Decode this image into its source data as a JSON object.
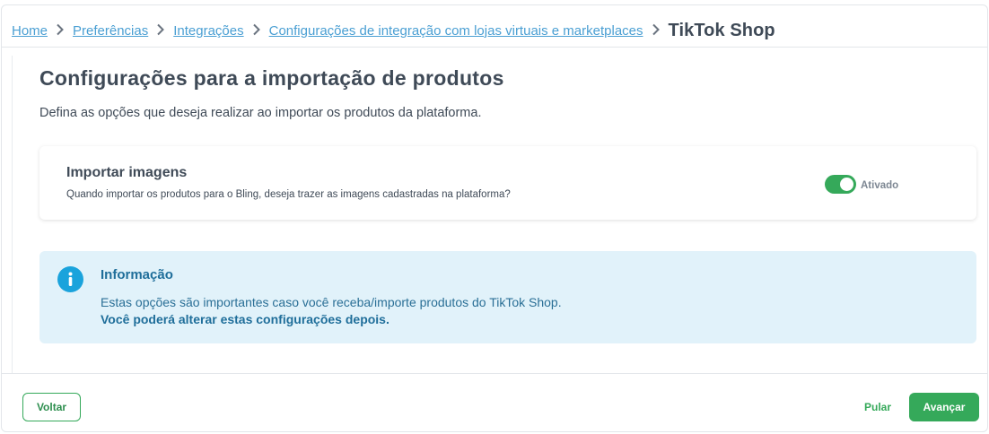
{
  "breadcrumb": {
    "items": [
      "Home",
      "Preferências",
      "Integrações",
      "Configurações de integração com lojas virtuais e marketplaces"
    ],
    "current": "TikTok Shop"
  },
  "main": {
    "title": "Configurações para a importação de produtos",
    "subtitle": "Defina as opções que deseja realizar ao importar os produtos da plataforma."
  },
  "import_images": {
    "title": "Importar imagens",
    "description": "Quando importar os produtos para o Bling, deseja trazer as imagens cadastradas na plataforma?",
    "enabled": true,
    "status_label": "Ativado"
  },
  "info": {
    "icon": "info-icon",
    "title": "Informação",
    "text": "Estas opções são importantes caso você receba/importe produtos do TikTok Shop.",
    "bold_text": "Você poderá alterar estas configurações depois."
  },
  "footer": {
    "back_label": "Voltar",
    "skip_label": "Pular",
    "next_label": "Avançar"
  },
  "colors": {
    "accent_green": "#35a95a",
    "link_blue": "#4a9fd3",
    "info_bg": "#e1f2fa",
    "info_icon_blue": "#1aa3dc"
  }
}
